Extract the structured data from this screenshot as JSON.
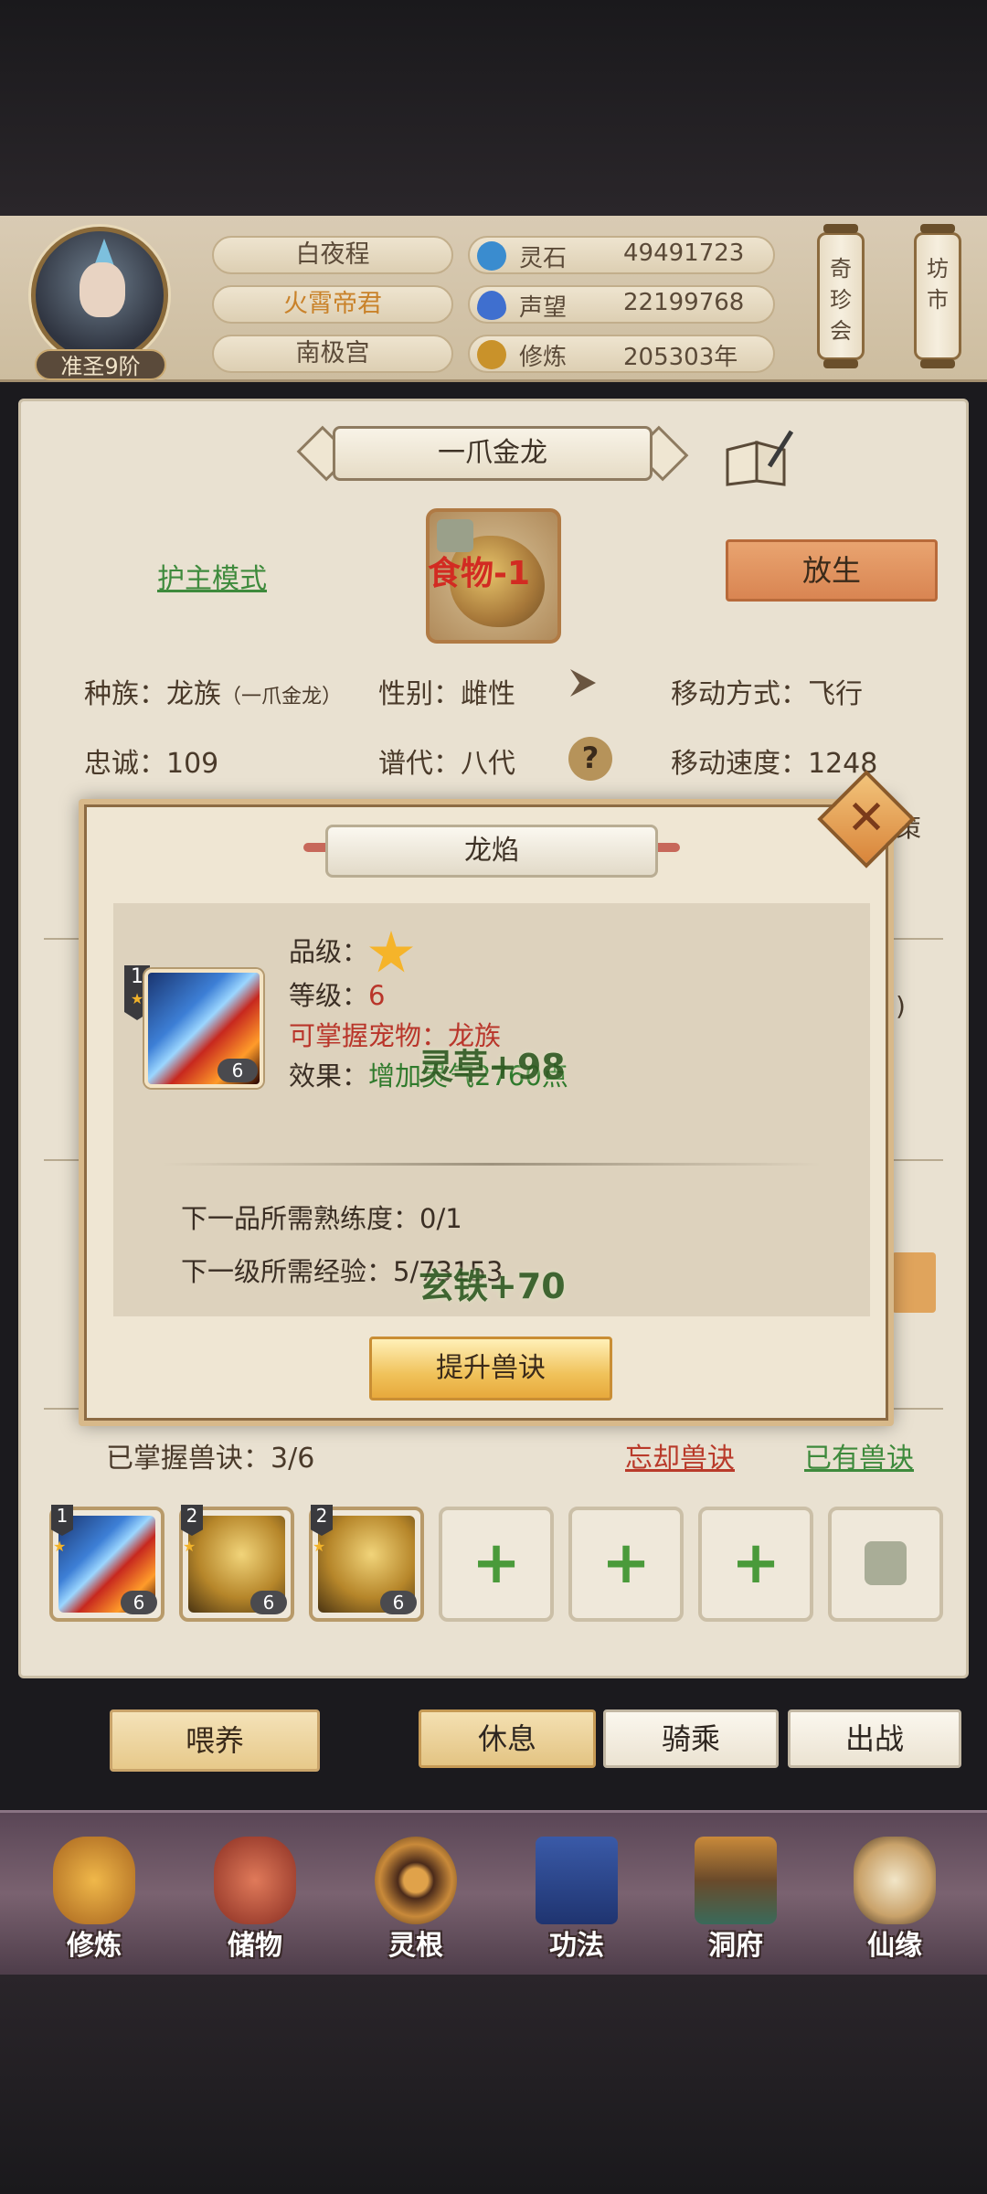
{
  "header": {
    "rank": "准圣9阶",
    "names": [
      "白夜程",
      "火霄帝君",
      "南极宫"
    ],
    "resources": [
      {
        "label": "灵石",
        "value": "49491723",
        "icon": "spirit-stone-icon",
        "color": "#3a8ccf"
      },
      {
        "label": "声望",
        "value": "22199768",
        "icon": "prestige-icon",
        "color": "#3f6fcf"
      },
      {
        "label": "修炼",
        "value": "205303年",
        "icon": "cultivation-icon",
        "color": "#c9922a"
      }
    ],
    "scroll_buttons": [
      "奇珍会",
      "坊市"
    ]
  },
  "pet": {
    "name": "一爪金龙",
    "guard_mode": "护主模式",
    "food_tag": "食物-1",
    "release": "放生",
    "stats": {
      "race_label": "种族：龙族",
      "race_sub": "（一爪金龙）",
      "gender": "性别：雌性",
      "move_type": "移动方式：飞行",
      "loyalty": "忠诚：109",
      "generation": "谱代：八代",
      "move_speed": "移动速度：1248"
    }
  },
  "behind": {
    "peek_right_1": "策",
    "peek_right_2": ")"
  },
  "skills": {
    "mastered": "已掌握兽诀：3/6",
    "forget": "忘却兽诀",
    "owned": "已有兽诀",
    "slots": [
      {
        "tier": "1",
        "level": "6",
        "art": "fire"
      },
      {
        "tier": "2",
        "level": "6",
        "art": "gold"
      },
      {
        "tier": "2",
        "level": "6",
        "art": "gold"
      }
    ]
  },
  "actions": {
    "feed": "喂养",
    "rest": "休息",
    "ride": "骑乘",
    "battle": "出战"
  },
  "nav": [
    "修炼",
    "储物",
    "灵根",
    "功法",
    "洞府",
    "仙缘"
  ],
  "modal": {
    "title": "龙焰",
    "tier": "1",
    "level": "6",
    "quality_label": "品级：",
    "grade": "等级：",
    "grade_value": "6",
    "pet_label": "可掌握宠物：龙族",
    "effect_label": "效果：",
    "effect_value": "增加灵气2760点",
    "next_quality": "下一品所需熟练度：0/1",
    "next_level": "下一级所需经验：5/73153",
    "upgrade": "提升兽诀",
    "close": "✕"
  },
  "floating": [
    "灵草+98",
    "玄铁+70"
  ]
}
